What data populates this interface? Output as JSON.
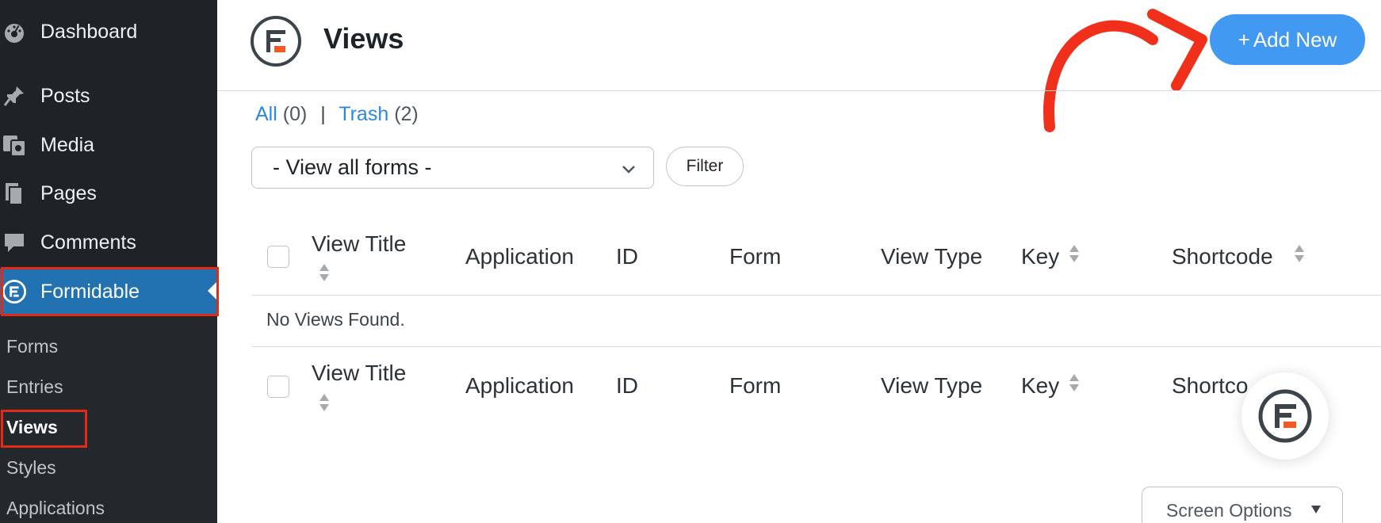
{
  "sidebar": {
    "menu": [
      {
        "label": "Dashboard",
        "icon": "dashboard-icon"
      },
      {
        "label": "Posts",
        "icon": "pin-icon"
      },
      {
        "label": "Media",
        "icon": "media-icon"
      },
      {
        "label": "Pages",
        "icon": "pages-icon"
      },
      {
        "label": "Comments",
        "icon": "comment-icon"
      },
      {
        "label": "Formidable",
        "icon": "formidable-icon"
      }
    ],
    "submenu": [
      "Forms",
      "Entries",
      "Views",
      "Styles",
      "Applications"
    ]
  },
  "header": {
    "title": "Views",
    "add_new_label": "Add New",
    "add_new_plus": "+"
  },
  "subsubsub": {
    "all_label": "All",
    "all_count": "(0)",
    "separator": "|",
    "trash_label": "Trash",
    "trash_count": "(2)"
  },
  "filter": {
    "select_value": "- View all forms -",
    "button_label": "Filter"
  },
  "table": {
    "columns": [
      "View Title",
      "Application",
      "ID",
      "Form",
      "View Type",
      "Key",
      "Shortcode"
    ],
    "footer_last_column": "Shortco",
    "empty_message": "No Views Found."
  },
  "screen_options": {
    "label": "Screen Options"
  },
  "colors": {
    "sidebar_bg": "#1d2327",
    "active_menu": "#2271b1",
    "accent_blue": "#4199f2",
    "highlight_red": "#e42a14",
    "brand_orange": "#f15a24"
  }
}
